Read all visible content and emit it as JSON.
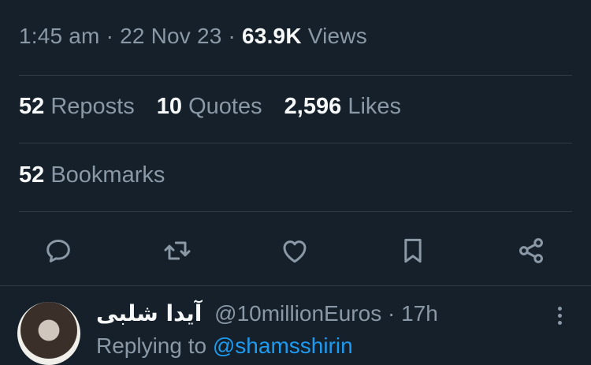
{
  "tweet_meta": {
    "time": "1:45 am",
    "separator": "·",
    "date": "22 Nov 23",
    "views_count": "63.9K",
    "views_label": "Views"
  },
  "stats": {
    "reposts": {
      "count": "52",
      "label": "Reposts"
    },
    "quotes": {
      "count": "10",
      "label": "Quotes"
    },
    "likes": {
      "count": "2,596",
      "label": "Likes"
    }
  },
  "bookmarks": {
    "count": "52",
    "label": "Bookmarks"
  },
  "actions": [
    {
      "icon": "reply-icon",
      "label": "Reply"
    },
    {
      "icon": "repost-icon",
      "label": "Repost"
    },
    {
      "icon": "heart-icon",
      "label": "Like"
    },
    {
      "icon": "bookmark-icon",
      "label": "Bookmark"
    },
    {
      "icon": "share-icon",
      "label": "Share"
    }
  ],
  "reply": {
    "display_name": "آیدا شلبی",
    "handle": "@10millionEuros",
    "separator": "·",
    "time": "17h",
    "replying_to_label": "Replying to",
    "replying_to_handle": "@shamsshirin"
  },
  "colors": {
    "background": "#15202b",
    "text_primary": "#f7f9f9",
    "text_secondary": "#8b98a5",
    "divider": "#2f3b47",
    "accent": "#1d9bf0"
  }
}
